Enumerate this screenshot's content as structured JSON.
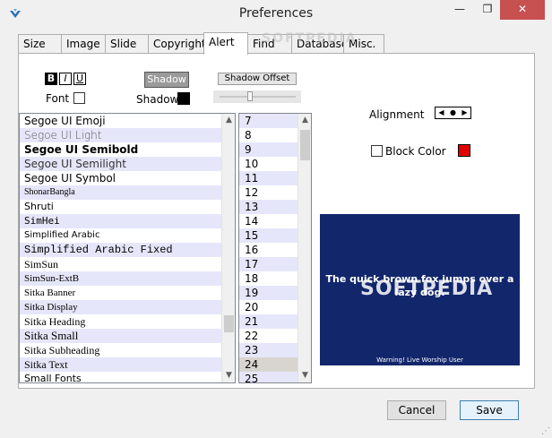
{
  "window": {
    "title": "Preferences",
    "minimize_glyph": "—",
    "maximize_glyph": "❐",
    "close_glyph": "✕"
  },
  "tabs": [
    {
      "label": "Size"
    },
    {
      "label": "Image"
    },
    {
      "label": "Slide"
    },
    {
      "label": "Copyright"
    },
    {
      "label": "Alert",
      "active": true
    },
    {
      "label": "Find"
    },
    {
      "label": "Database"
    },
    {
      "label": "Misc."
    }
  ],
  "style_toggles": {
    "bold": "B",
    "italic": "I",
    "underline": "U"
  },
  "font_label": "Font",
  "shadow_button": "Shadow",
  "shadow_label": "Shadow",
  "shadow_offset_button": "Shadow Offset",
  "slider": {
    "level": 0.42
  },
  "font_list": [
    "Segoe UI Emoji",
    "Segoe UI Light",
    "Segoe UI Semibold",
    "Segoe UI Semilight",
    "Segoe UI Symbol",
    "ShonarBangla",
    "Shruti",
    "SimHei",
    "Simplified Arabic",
    "Simplified Arabic Fixed",
    "SimSun",
    "SimSun-ExtB",
    "Sitka Banner",
    "Sitka Display",
    "Sitka Heading",
    "Sitka Small",
    "Sitka Subheading",
    "Sitka Text",
    "Small Fonts"
  ],
  "size_list": [
    "7",
    "8",
    "9",
    "10",
    "11",
    "12",
    "13",
    "14",
    "15",
    "16",
    "17",
    "18",
    "19",
    "20",
    "21",
    "22",
    "23",
    "24",
    "25"
  ],
  "selected_size": "24",
  "alignment_label": "Alignment",
  "alignment_buttons": {
    "left": "◀",
    "center": "●",
    "right": "▶"
  },
  "block_color_label": "Block Color",
  "preview": {
    "text": "The quick brown fox jumps over a lazy dog.",
    "footer": "Warning! Live Worship User"
  },
  "watermark": "SOFTPEDIA",
  "cancel_button": "Cancel",
  "save_button": "Save",
  "colors": {
    "preview_bg": "#12266b",
    "block_color": "#e00000",
    "shadow_color": "#000000",
    "list_alt_row": "#e6e6fa"
  }
}
